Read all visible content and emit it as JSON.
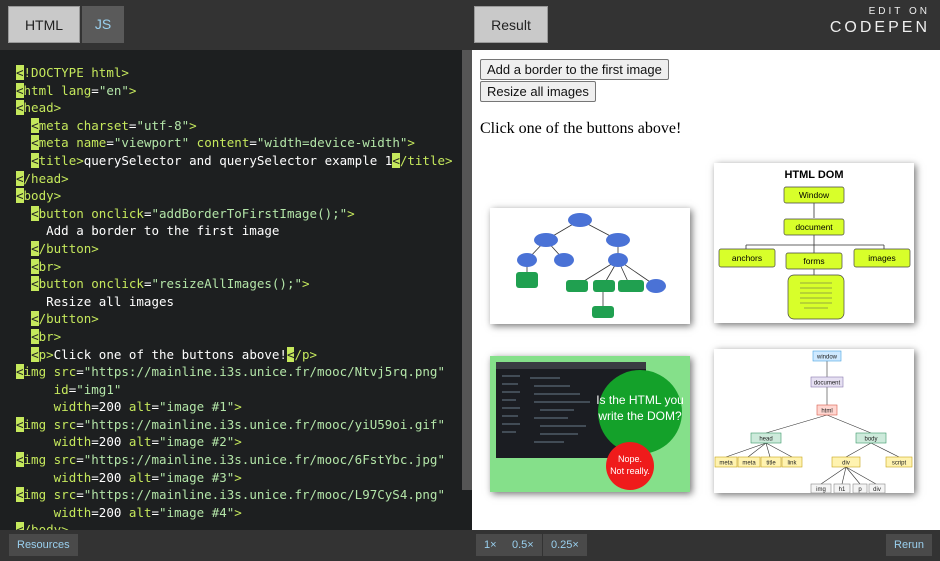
{
  "editor": {
    "tab_html": "HTML",
    "tab_js": "JS",
    "lines": [
      [
        [
          "sel",
          "<"
        ],
        [
          "tg",
          "!DOCTYPE html>"
        ]
      ],
      [
        [
          "sel",
          "<"
        ],
        [
          "tg",
          "html "
        ],
        [
          "at",
          "lang"
        ],
        [
          "tx",
          "="
        ],
        [
          "st",
          "\"en\""
        ],
        [
          "tg",
          ">"
        ]
      ],
      [
        [
          "sel",
          "<"
        ],
        [
          "tg",
          "head>"
        ]
      ],
      [
        [
          "tx",
          "  "
        ],
        [
          "sel",
          "<"
        ],
        [
          "tg",
          "meta "
        ],
        [
          "at",
          "charset"
        ],
        [
          "tx",
          "="
        ],
        [
          "st",
          "\"utf-8\""
        ],
        [
          "tg",
          ">"
        ]
      ],
      [
        [
          "tx",
          "  "
        ],
        [
          "sel",
          "<"
        ],
        [
          "tg",
          "meta "
        ],
        [
          "at",
          "name"
        ],
        [
          "tx",
          "="
        ],
        [
          "st",
          "\"viewport\""
        ],
        [
          "tx",
          " "
        ],
        [
          "at",
          "content"
        ],
        [
          "tx",
          "="
        ],
        [
          "st",
          "\"width=device-width\""
        ],
        [
          "tg",
          ">"
        ]
      ],
      [
        [
          "tx",
          "  "
        ],
        [
          "sel",
          "<"
        ],
        [
          "tg",
          "title>"
        ],
        [
          "tx",
          "querySelector and querySelector example 1"
        ],
        [
          "sel",
          "<"
        ],
        [
          "tg",
          "/title>"
        ]
      ],
      [
        [
          "sel",
          "<"
        ],
        [
          "tg",
          "/head>"
        ]
      ],
      [
        [
          "sel",
          "<"
        ],
        [
          "tg",
          "body>"
        ]
      ],
      [
        [
          "tx",
          "  "
        ],
        [
          "sel",
          "<"
        ],
        [
          "tg",
          "button "
        ],
        [
          "at",
          "onclick"
        ],
        [
          "tx",
          "="
        ],
        [
          "st",
          "\"addBorderToFirstImage();\""
        ],
        [
          "tg",
          ">"
        ]
      ],
      [
        [
          "tx",
          "    Add a border to the first image"
        ]
      ],
      [
        [
          "tx",
          "  "
        ],
        [
          "sel",
          "<"
        ],
        [
          "tg",
          "/button>"
        ]
      ],
      [
        [
          "tx",
          "  "
        ],
        [
          "sel",
          "<"
        ],
        [
          "tg",
          "br>"
        ]
      ],
      [
        [
          "tx",
          "  "
        ],
        [
          "sel",
          "<"
        ],
        [
          "tg",
          "button "
        ],
        [
          "at",
          "onclick"
        ],
        [
          "tx",
          "="
        ],
        [
          "st",
          "\"resizeAllImages();\""
        ],
        [
          "tg",
          ">"
        ]
      ],
      [
        [
          "tx",
          "    Resize all images"
        ]
      ],
      [
        [
          "tx",
          "  "
        ],
        [
          "sel",
          "<"
        ],
        [
          "tg",
          "/button>"
        ]
      ],
      [
        [
          "tx",
          "  "
        ],
        [
          "sel",
          "<"
        ],
        [
          "tg",
          "br>"
        ]
      ],
      [
        [
          "tx",
          "  "
        ],
        [
          "sel",
          "<"
        ],
        [
          "tg",
          "p>"
        ],
        [
          "tx",
          "Click one of the buttons above!"
        ],
        [
          "sel",
          "<"
        ],
        [
          "tg",
          "/p>"
        ]
      ],
      [
        [
          "sel",
          "<"
        ],
        [
          "tg",
          "img "
        ],
        [
          "at",
          "src"
        ],
        [
          "tx",
          "="
        ],
        [
          "st",
          "\"https://mainline.i3s.unice.fr/mooc/Ntvj5rq.png\""
        ]
      ],
      [
        [
          "tx",
          "     "
        ],
        [
          "at",
          "id"
        ],
        [
          "tx",
          "="
        ],
        [
          "st",
          "\"img1\""
        ]
      ],
      [
        [
          "tx",
          "     "
        ],
        [
          "at",
          "width"
        ],
        [
          "tx",
          "=200 "
        ],
        [
          "at",
          "alt"
        ],
        [
          "tx",
          "="
        ],
        [
          "st",
          "\"image #1\""
        ],
        [
          "tg",
          ">"
        ]
      ],
      [
        [
          "sel",
          "<"
        ],
        [
          "tg",
          "img "
        ],
        [
          "at",
          "src"
        ],
        [
          "tx",
          "="
        ],
        [
          "st",
          "\"https://mainline.i3s.unice.fr/mooc/yiU59oi.gif\""
        ]
      ],
      [
        [
          "tx",
          "     "
        ],
        [
          "at",
          "width"
        ],
        [
          "tx",
          "=200 "
        ],
        [
          "at",
          "alt"
        ],
        [
          "tx",
          "="
        ],
        [
          "st",
          "\"image #2\""
        ],
        [
          "tg",
          ">"
        ]
      ],
      [
        [
          "sel",
          "<"
        ],
        [
          "tg",
          "img "
        ],
        [
          "at",
          "src"
        ],
        [
          "tx",
          "="
        ],
        [
          "st",
          "\"https://mainline.i3s.unice.fr/mooc/6FstYbc.jpg\""
        ]
      ],
      [
        [
          "tx",
          "     "
        ],
        [
          "at",
          "width"
        ],
        [
          "tx",
          "=200 "
        ],
        [
          "at",
          "alt"
        ],
        [
          "tx",
          "="
        ],
        [
          "st",
          "\"image #3\""
        ],
        [
          "tg",
          ">"
        ]
      ],
      [
        [
          "sel",
          "<"
        ],
        [
          "tg",
          "img "
        ],
        [
          "at",
          "src"
        ],
        [
          "tx",
          "="
        ],
        [
          "st",
          "\"https://mainline.i3s.unice.fr/mooc/L97CyS4.png\""
        ]
      ],
      [
        [
          "tx",
          "     "
        ],
        [
          "at",
          "width"
        ],
        [
          "tx",
          "=200 "
        ],
        [
          "at",
          "alt"
        ],
        [
          "tx",
          "="
        ],
        [
          "st",
          "\"image #4\""
        ],
        [
          "tg",
          ">"
        ]
      ],
      [
        [
          "sel",
          "<"
        ],
        [
          "tg",
          "/body>"
        ]
      ]
    ]
  },
  "result": {
    "tab_label": "Result",
    "brand_edit": "EDIT ON",
    "brand_name": "CODEPEN",
    "button1": "Add a border to the first image",
    "button2": "Resize all images",
    "prompt": "Click one of the buttons above!",
    "img2": {
      "title": "HTML DOM",
      "window": "Window",
      "document": "document",
      "anchors": "anchors",
      "forms": "forms",
      "images": "images"
    },
    "img3": {
      "line1": "Is the HTML you",
      "line2": "write the DOM?",
      "line3": "Nope.",
      "line4": "Not really."
    },
    "img4": {
      "window": "window",
      "document": "document",
      "html": "html",
      "head": "head",
      "body": "body",
      "meta1": "meta",
      "meta2": "meta",
      "title": "title",
      "link": "link",
      "div": "div",
      "script": "script",
      "img": "img",
      "h1": "h1",
      "p": "p",
      "div2": "div"
    }
  },
  "bottom": {
    "resources": "Resources",
    "zoom_1x": "1×",
    "zoom_05x": "0.5×",
    "zoom_025x": "0.25×",
    "rerun": "Rerun"
  },
  "colors": {
    "accent": "#c5e85c",
    "editor_bg": "#1d1f20",
    "link_blue": "#9ad0ef"
  }
}
